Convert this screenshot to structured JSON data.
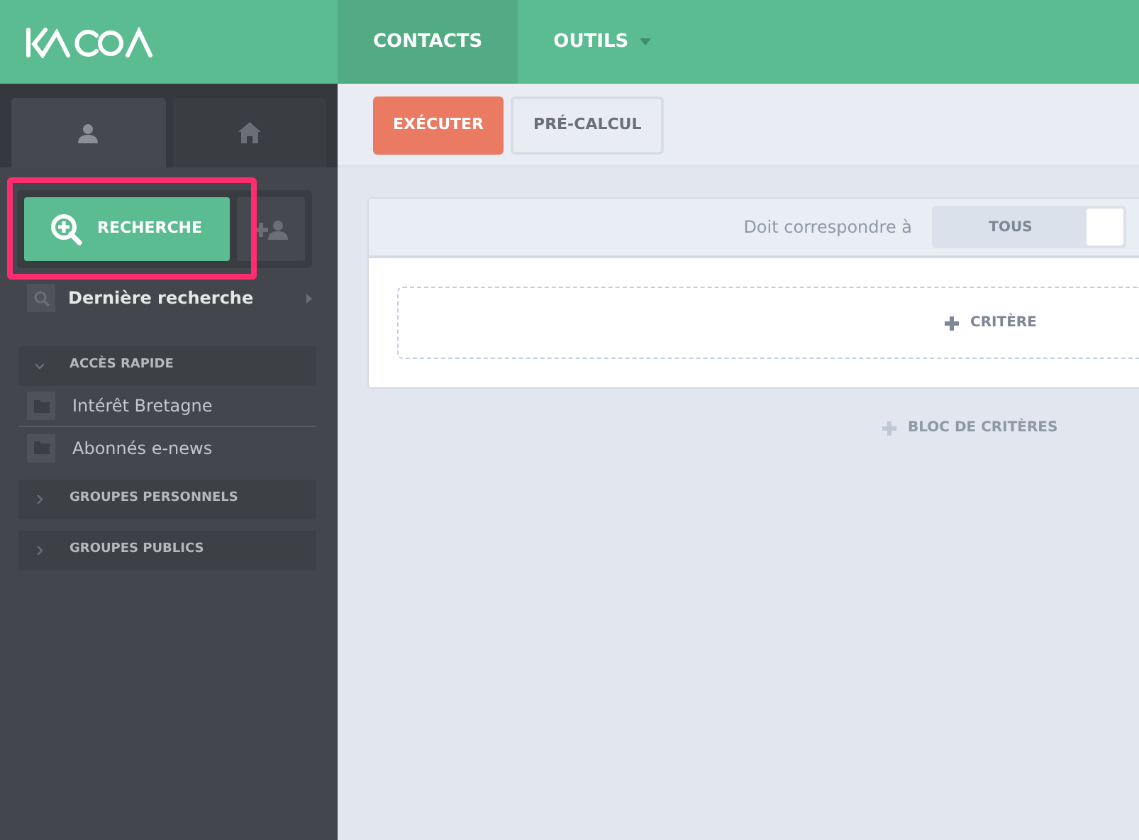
{
  "navbar": {
    "items": [
      {
        "label": "CONTACTS",
        "selected": true,
        "dropdown": false
      },
      {
        "label": "OUTILS",
        "selected": false,
        "dropdown": true
      }
    ]
  },
  "sidebar": {
    "tabs": [
      {
        "kind": "person",
        "selected": true
      },
      {
        "kind": "home",
        "selected": false
      }
    ],
    "search_button": {
      "label": "RECHERCHE",
      "highlighted": true
    },
    "last_search": {
      "label": "Dernière recherche"
    },
    "sections": [
      {
        "label": "ACCÈS RAPIDE",
        "expanded": true,
        "children": [
          {
            "label": "Intérêt Bretagne"
          },
          {
            "label": "Abonnés e-news"
          }
        ]
      },
      {
        "label": "GROUPES PERSONNELS",
        "expanded": false
      },
      {
        "label": "GROUPES PUBLICS",
        "expanded": false
      }
    ]
  },
  "toolbar": {
    "buttons": [
      {
        "label": "EXÉCUTER",
        "kind": "primary"
      },
      {
        "label": "PRÉ-CALCUL",
        "kind": "secondary"
      }
    ]
  },
  "criteria": {
    "match_label": "Doit correspondre à",
    "match_toggle": {
      "label": "TOUS",
      "on": false
    },
    "add_criterion": "CRITÈRE",
    "add_block": "BLOC DE CRITÈRES"
  }
}
